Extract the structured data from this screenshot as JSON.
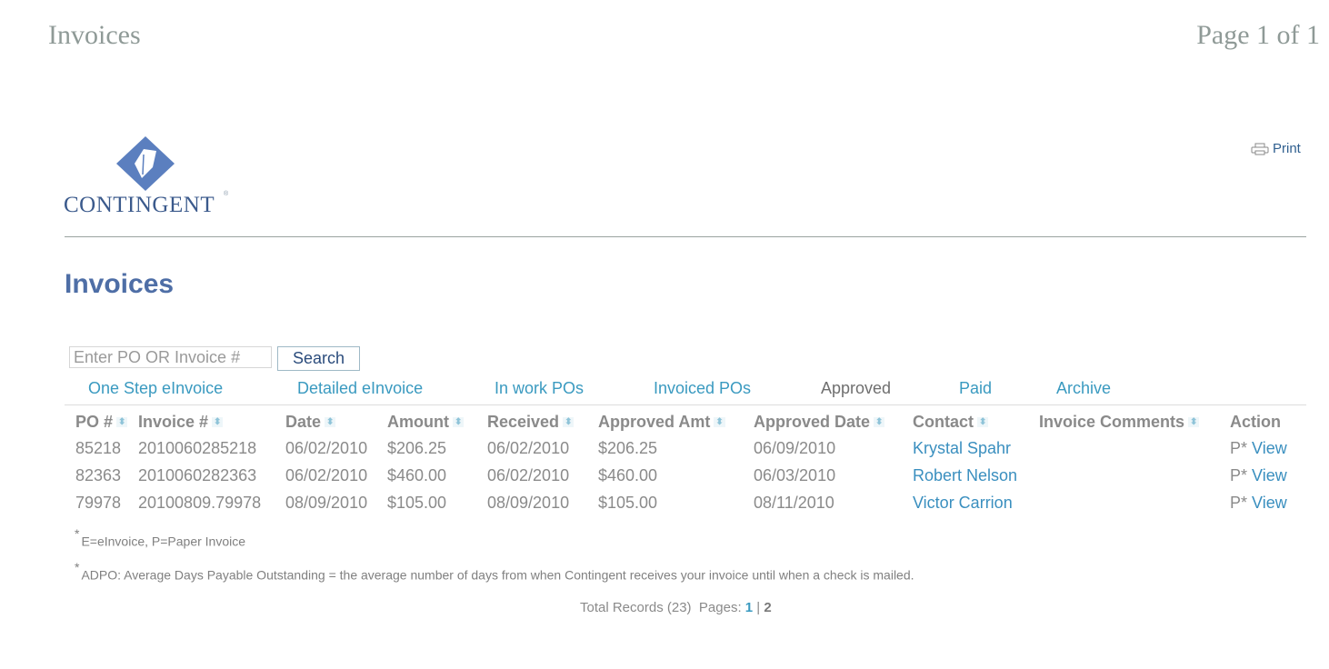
{
  "print_header": {
    "title": "Invoices",
    "page_indicator": "Page 1 of 1"
  },
  "logo": {
    "text": "CONTINGENT",
    "reg_mark": "®",
    "color": "#4e6ea6"
  },
  "print_link": {
    "label": "Print",
    "icon": "printer-icon"
  },
  "page_title": "Invoices",
  "search": {
    "placeholder": "Enter PO OR Invoice #",
    "value": "",
    "button_label": "Search"
  },
  "tabs": [
    {
      "label": "One Step eInvoice",
      "active": false
    },
    {
      "label": "Detailed eInvoice",
      "active": false
    },
    {
      "label": "In work POs",
      "active": false
    },
    {
      "label": "Invoiced POs",
      "active": false
    },
    {
      "label": "Approved",
      "active": true
    },
    {
      "label": "Paid",
      "active": false
    },
    {
      "label": "Archive",
      "active": false
    }
  ],
  "table": {
    "columns": [
      "PO #",
      "Invoice #",
      "Date",
      "Amount",
      "Received",
      "Approved Amt",
      "Approved Date",
      "Contact",
      "Invoice Comments",
      "Action"
    ],
    "rows": [
      {
        "po": "85218",
        "invoice": "2010060285218",
        "date": "06/02/2010",
        "amount": "$206.25",
        "received": "06/02/2010",
        "approved_amt": "$206.25",
        "approved_date": "06/09/2010",
        "contact": "Krystal Spahr",
        "comments": "",
        "type": "P*",
        "action": "View"
      },
      {
        "po": "82363",
        "invoice": "2010060282363",
        "date": "06/02/2010",
        "amount": "$460.00",
        "received": "06/02/2010",
        "approved_amt": "$460.00",
        "approved_date": "06/03/2010",
        "contact": "Robert Nelson",
        "comments": "",
        "type": "P*",
        "action": "View"
      },
      {
        "po": "79978",
        "invoice": "20100809.79978",
        "date": "08/09/2010",
        "amount": "$105.00",
        "received": "08/09/2010",
        "approved_amt": "$105.00",
        "approved_date": "08/11/2010",
        "contact": "Victor Carrion",
        "comments": "",
        "type": "P*",
        "action": "View"
      }
    ]
  },
  "notes": [
    {
      "mark": "*",
      "text": "E=eInvoice, P=Paper Invoice"
    },
    {
      "mark": "*",
      "text": "ADPO: Average Days Payable Outstanding = the average number of days from when Contingent receives your invoice until when a check is mailed."
    }
  ],
  "footer": {
    "total_label": "Total Records (23)",
    "pages_label": "Pages:",
    "page1": "1",
    "separator": "|",
    "page2": "2"
  }
}
